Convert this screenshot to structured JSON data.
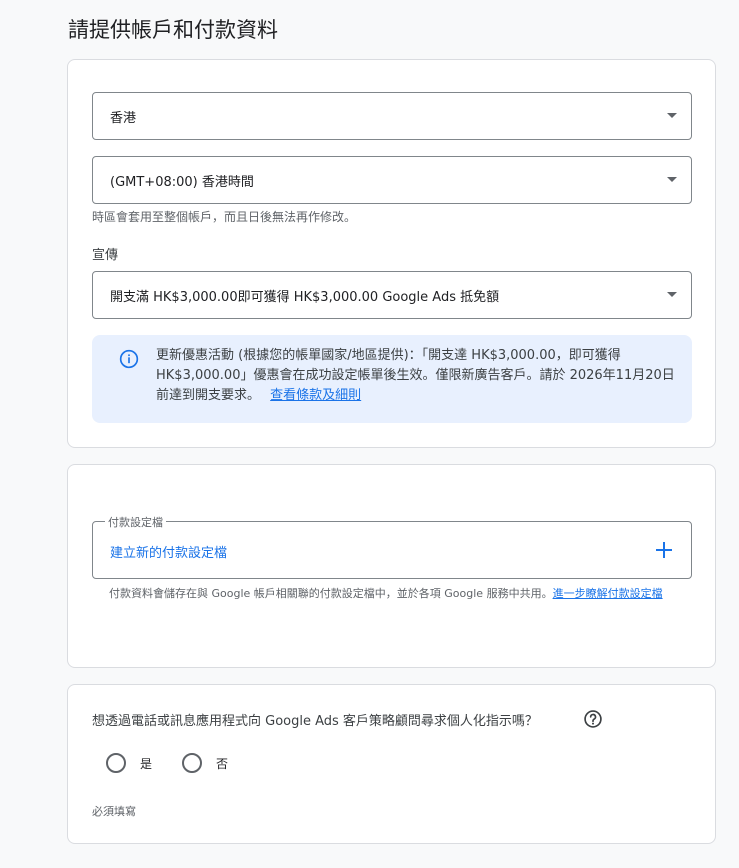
{
  "page": {
    "title": "請提供帳戶和付款資料"
  },
  "account": {
    "country": {
      "value": "香港"
    },
    "timezone": {
      "value": "(GMT+08:00) 香港時間",
      "hint": "時區會套用至整個帳戶，而且日後無法再作修改。"
    },
    "promotion": {
      "label": "宣傳",
      "value": "開支滿 HK$3,000.00即可獲得 HK$3,000.00 Google Ads 抵免額"
    },
    "info": {
      "text": "更新優惠活動 (根據您的帳單國家/地區提供)：「開支達 HK$3,000.00，即可獲得 HK$3,000.00」優惠會在成功設定帳單後生效。僅限新廣告客戶。請於 2026年11月20日前達到開支要求。",
      "link": "查看條款及細則",
      "icon": "info-icon"
    }
  },
  "payment": {
    "profile_label": "付款設定檔",
    "create_label": "建立新的付款設定檔",
    "note": "付款資料會儲存在與 Google 帳戶相關聯的付款設定檔中，並於各項 Google 服務中共用。",
    "note_link": "進一步瞭解付款設定檔",
    "icon": "plus-icon"
  },
  "consult": {
    "question": "想透過電話或訊息應用程式向 Google Ads 客戶策略顧問尋求個人化指示嗎？",
    "options": [
      {
        "label": "是"
      },
      {
        "label": "否"
      }
    ],
    "required": "必須填寫",
    "icon": "help-icon"
  },
  "colors": {
    "accent": "#1a73e8",
    "info_bg": "#e8f0fe",
    "border": "#dadce0"
  }
}
